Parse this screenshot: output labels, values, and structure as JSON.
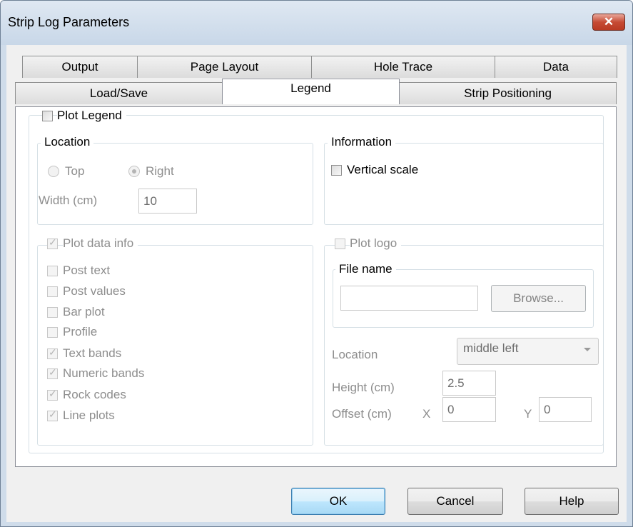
{
  "window": {
    "title": "Strip Log Parameters",
    "close_glyph": "✕"
  },
  "tabs": {
    "row1": [
      "Output",
      "Page Layout",
      "Hole Trace",
      "Data"
    ],
    "row2": [
      "Load/Save",
      "Legend",
      "Strip Positioning"
    ],
    "active": "Legend"
  },
  "legend": {
    "plot_legend": {
      "label": "Plot Legend",
      "checked": false
    },
    "location": {
      "title": "Location",
      "top_label": "Top",
      "right_label": "Right",
      "selected": "Right",
      "width_label": "Width (cm)",
      "width_value": "10"
    },
    "information": {
      "title": "Information",
      "vertical_scale": {
        "label": "Vertical scale",
        "checked": false
      }
    },
    "plot_data_info": {
      "label": "Plot data info",
      "checked": true,
      "items": [
        {
          "label": "Post text",
          "checked": false
        },
        {
          "label": "Post values",
          "checked": false
        },
        {
          "label": "Bar plot",
          "checked": false
        },
        {
          "label": "Profile",
          "checked": false
        },
        {
          "label": "Text bands",
          "checked": true
        },
        {
          "label": "Numeric bands",
          "checked": true
        },
        {
          "label": "Rock codes",
          "checked": true
        },
        {
          "label": "Line plots",
          "checked": true
        }
      ]
    },
    "plot_logo": {
      "label": "Plot logo",
      "checked": false,
      "file_name_title": "File name",
      "file_name_value": "",
      "browse_label": "Browse...",
      "location_label": "Location",
      "location_value": "middle left",
      "height_label": "Height (cm)",
      "height_value": "2.5",
      "offset_label": "Offset (cm)",
      "x_label": "X",
      "x_value": "0",
      "y_label": "Y",
      "y_value": "0"
    }
  },
  "buttons": {
    "ok": "OK",
    "cancel": "Cancel",
    "help": "Help"
  },
  "colors": {
    "title_bar": "#c8d7e8",
    "close_button": "#c64b35",
    "default_button": "#3c7fb1"
  }
}
